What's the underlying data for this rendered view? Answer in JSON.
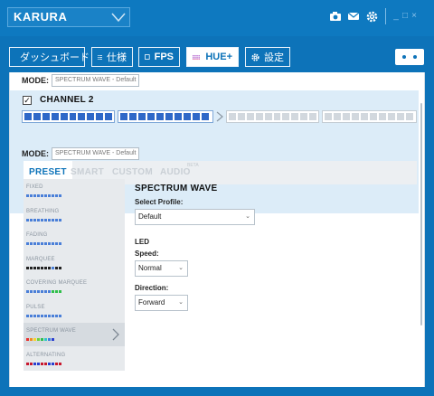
{
  "titlebar": {
    "product": "KARURA",
    "icons": [
      "camera-icon",
      "mail-icon",
      "gear-icon"
    ],
    "window_controls": [
      "_",
      "□",
      "×"
    ]
  },
  "nav": {
    "tabs": [
      {
        "label": "ダッシュボード",
        "icon": "speedometer-icon",
        "active": false
      },
      {
        "label": "仕様",
        "icon": "list-icon",
        "active": false
      },
      {
        "label": "FPS",
        "icon": "square-icon",
        "active": false
      },
      {
        "label": "HUE+",
        "icon": "led-grid-icon",
        "active": true
      },
      {
        "label": "設定",
        "icon": "gear-icon",
        "active": false
      }
    ]
  },
  "channel1": {
    "mode_label": "MODE:",
    "mode_value": "SPECTRUM WAVE - Default"
  },
  "channel2": {
    "checked": true,
    "check_mark": "✓",
    "label": "CHANNEL 2",
    "mode_label": "MODE:",
    "mode_value": "SPECTRUM WAVE - Default",
    "strips_active": [
      true,
      true,
      false,
      false
    ],
    "leds_per_strip": 10
  },
  "subtabs": [
    {
      "label": "PRESET",
      "active": true
    },
    {
      "label": "SMART",
      "active": false
    },
    {
      "label": "CUSTOM",
      "active": false
    },
    {
      "label": "AUDIO",
      "active": false,
      "badge": "BETA"
    }
  ],
  "presets": [
    {
      "name": "FIXED",
      "colors": [
        "#4a7fd8",
        "#4a7fd8",
        "#4a7fd8",
        "#4a7fd8",
        "#4a7fd8",
        "#4a7fd8",
        "#4a7fd8",
        "#4a7fd8",
        "#4a7fd8",
        "#4a7fd8"
      ]
    },
    {
      "name": "BREATHING",
      "colors": [
        "#4a7fd8",
        "#4a7fd8",
        "#4a7fd8",
        "#4a7fd8",
        "#4a7fd8",
        "#4a7fd8",
        "#4a7fd8",
        "#4a7fd8",
        "#4a7fd8",
        "#4a7fd8"
      ]
    },
    {
      "name": "FADING",
      "colors": [
        "#4a7fd8",
        "#4a7fd8",
        "#4a7fd8",
        "#4a7fd8",
        "#4a7fd8",
        "#4a7fd8",
        "#4a7fd8",
        "#4a7fd8",
        "#4a7fd8",
        "#4a7fd8"
      ]
    },
    {
      "name": "MARQUEE",
      "colors": [
        "#222",
        "#222",
        "#222",
        "#222",
        "#222",
        "#222",
        "#222",
        "#4a7fd8",
        "#222",
        "#222"
      ]
    },
    {
      "name": "COVERING MARQUEE",
      "colors": [
        "#4a7fd8",
        "#4a7fd8",
        "#4a7fd8",
        "#4a7fd8",
        "#4a7fd8",
        "#4a7fd8",
        "#4a7fd8",
        "#2fbf4a",
        "#2fbf4a",
        "#2fbf4a"
      ]
    },
    {
      "name": "PULSE",
      "colors": [
        "#4a7fd8",
        "#4a7fd8",
        "#4a7fd8",
        "#4a7fd8",
        "#4a7fd8",
        "#4a7fd8",
        "#4a7fd8",
        "#4a7fd8",
        "#4a7fd8",
        "#4a7fd8"
      ]
    },
    {
      "name": "SPECTRUM WAVE",
      "colors": [
        "#e8312f",
        "#f28a1e",
        "#f6d42a",
        "#6cd13a",
        "#2fbf4a",
        "#2fc7c7",
        "#3a7fe0",
        "#2a3fd0"
      ],
      "selected": true
    },
    {
      "name": "ALTERNATING",
      "colors": [
        "#c8182e",
        "#c8182e",
        "#2a3fd0",
        "#2a3fd0",
        "#c8182e",
        "#c8182e",
        "#2a3fd0",
        "#2a3fd0",
        "#c8182e",
        "#c8182e"
      ]
    }
  ],
  "detail": {
    "title": "SPECTRUM WAVE",
    "profile_label": "Select Profile:",
    "profile_value": "Default",
    "section_label": "LED",
    "speed_label": "Speed:",
    "speed_value": "Normal",
    "direction_label": "Direction:",
    "direction_value": "Forward"
  },
  "colors": {
    "brand_blue": "#0d73b9",
    "led_active": "#2e68c8",
    "led_inactive": "#d2d8de",
    "channel_bg": "#dcecf8"
  }
}
